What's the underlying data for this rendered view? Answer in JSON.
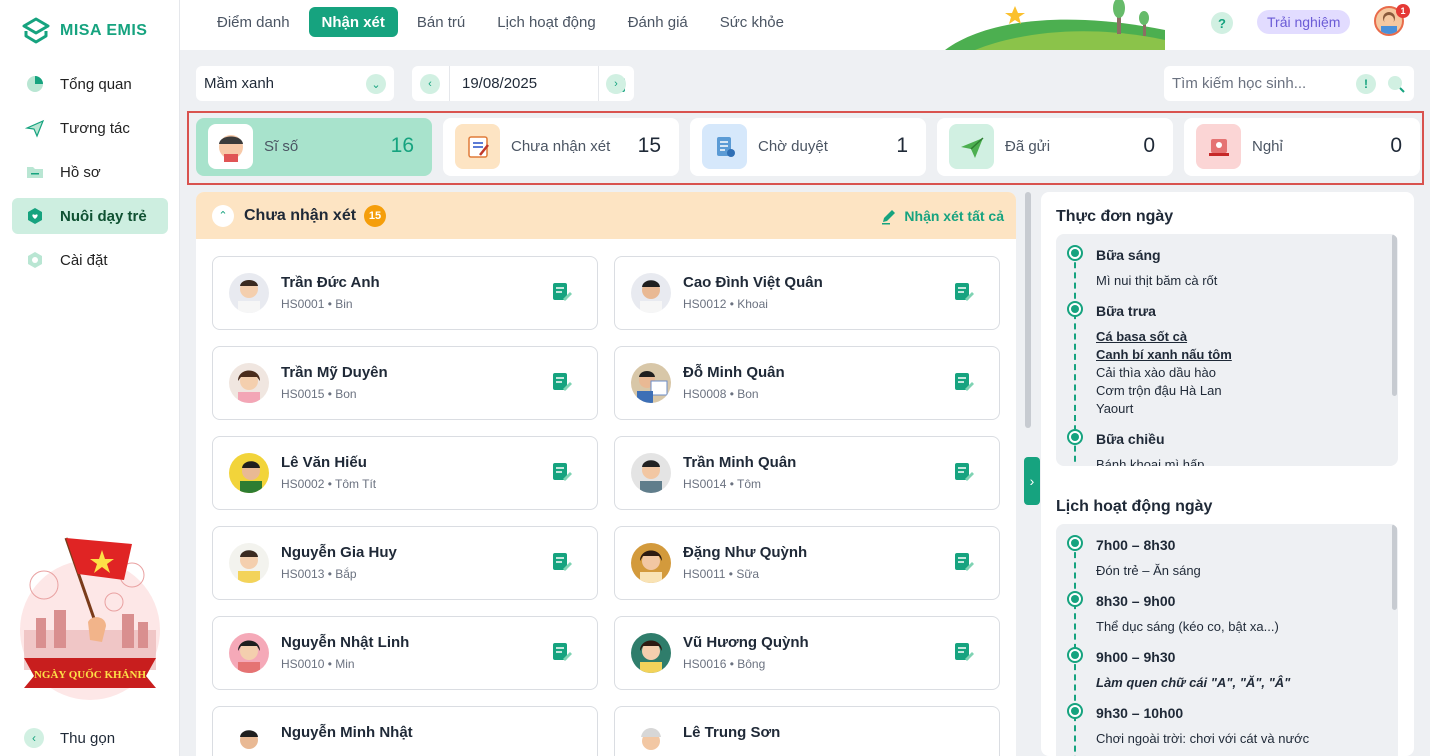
{
  "brand": {
    "name": "MISA EMIS"
  },
  "sidebar": {
    "items": [
      {
        "label": "Tổng quan",
        "icon": "chart-pie-icon"
      },
      {
        "label": "Tương tác",
        "icon": "paper-plane-icon"
      },
      {
        "label": "Hồ sơ",
        "icon": "folder-icon"
      },
      {
        "label": "Nuôi dạy trẻ",
        "icon": "heart-icon",
        "active": true
      },
      {
        "label": "Cài đặt",
        "icon": "gear-icon"
      }
    ],
    "festival_text": "NGÀY QUỐC KHÁNH",
    "collapse_label": "Thu gọn"
  },
  "topbar": {
    "tabs": [
      {
        "label": "Điểm danh"
      },
      {
        "label": "Nhận xét",
        "active": true
      },
      {
        "label": "Bán trú"
      },
      {
        "label": "Lịch hoạt động"
      },
      {
        "label": "Đánh giá"
      },
      {
        "label": "Sức khỏe"
      }
    ],
    "help": "?",
    "trial": "Trải nghiệm",
    "notification_count": "1"
  },
  "filters": {
    "class": "Mầm xanh",
    "date": "19/08/2025",
    "search_placeholder": "Tìm kiếm học sinh...",
    "search_warning": "!"
  },
  "stats": [
    {
      "label": "Sĩ số",
      "value": "16",
      "color": "#a8e3cc"
    },
    {
      "label": "Chưa nhận xét",
      "value": "15",
      "color": "#fde4c3"
    },
    {
      "label": "Chờ duyệt",
      "value": "1",
      "color": "#d6e8fb"
    },
    {
      "label": "Đã gửi",
      "value": "0",
      "color": "#d1f0e2"
    },
    {
      "label": "Nghỉ",
      "value": "0",
      "color": "#fbd5d5"
    }
  ],
  "panel": {
    "title": "Chưa nhận xét",
    "count": "15",
    "comment_all": "Nhận xét tất cả",
    "students": [
      {
        "name": "Trần Đức Anh",
        "code": "HS0001 • Bin"
      },
      {
        "name": "Cao Đình Việt Quân",
        "code": "HS0012 • Khoai"
      },
      {
        "name": "Trần Mỹ Duyên",
        "code": "HS0015 • Bon"
      },
      {
        "name": "Đỗ Minh Quân",
        "code": "HS0008 • Bon"
      },
      {
        "name": "Lê Văn Hiếu",
        "code": "HS0002 • Tôm Tít"
      },
      {
        "name": "Trần Minh Quân",
        "code": "HS0014 • Tôm"
      },
      {
        "name": "Nguyễn Gia Huy",
        "code": "HS0013 • Bắp"
      },
      {
        "name": "Đặng Như Quỳnh",
        "code": "HS0011 • Sữa"
      },
      {
        "name": "Nguyễn Nhật Linh",
        "code": "HS0010 • Min"
      },
      {
        "name": "Vũ Hương Quỳnh",
        "code": "HS0016 • Bông"
      },
      {
        "name": "Nguyễn Minh Nhật",
        "code": ""
      },
      {
        "name": "Lê Trung Sơn",
        "code": ""
      }
    ]
  },
  "menu": {
    "title": "Thực đơn ngày",
    "meals": [
      {
        "title": "Bữa sáng",
        "lines": [
          "Mì nui thịt băm cà rốt"
        ]
      },
      {
        "title": "Bữa trưa",
        "lines": [
          "Cá basa sốt cà",
          "Canh bí xanh nấu tôm",
          "Cải thìa xào dầu hào",
          "Cơm trộn đậu Hà Lan",
          "Yaourt"
        ]
      },
      {
        "title": "Bữa chiều",
        "lines": [
          "Bánh khoai mì hấp"
        ]
      }
    ]
  },
  "schedule": {
    "title": "Lịch hoạt động ngày",
    "items": [
      {
        "time": "7h00 – 8h30",
        "text": "Đón trẻ – Ăn sáng"
      },
      {
        "time": "8h30 – 9h00",
        "text": "Thể dục sáng (kéo co, bật xa...)"
      },
      {
        "time": "9h00 – 9h30",
        "text": "Làm quen chữ cái \"A\", \"Ă\", \"Â\""
      },
      {
        "time": "9h30 – 10h00",
        "text": "Chơi ngoài trời: chơi với cát và nước"
      }
    ]
  }
}
